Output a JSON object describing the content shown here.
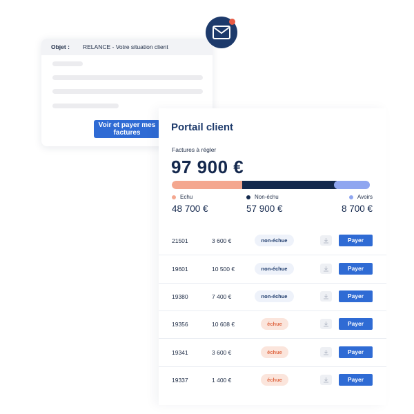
{
  "email": {
    "subject_label": "Objet :",
    "subject_value": "RELANCE - Votre situation client",
    "cta_label": "Voir et payer mes factures",
    "icon": "mail-icon"
  },
  "portal": {
    "title": "Portail client",
    "subtitle": "Factures à régler",
    "total": "97 900 €",
    "breakdown": [
      {
        "label": "Echu",
        "amount": "48 700 €",
        "color": "#f4a78f",
        "share": 0.35
      },
      {
        "label": "Non-échu",
        "amount": "57 900 €",
        "color": "#13294d",
        "share": 0.47
      },
      {
        "label": "Avoirs",
        "amount": "8 700 €",
        "color": "#8fa6f0",
        "share": 0.18
      }
    ],
    "pay_label": "Payer",
    "invoices": [
      {
        "id": "21501",
        "amount": "3 600 €",
        "status": "non-échue",
        "status_kind": "notdue"
      },
      {
        "id": "19601",
        "amount": "10 500 €",
        "status": "non-échue",
        "status_kind": "notdue"
      },
      {
        "id": "19380",
        "amount": "7 400 €",
        "status": "non-échue",
        "status_kind": "notdue"
      },
      {
        "id": "19356",
        "amount": "10 608 €",
        "status": "échue",
        "status_kind": "overdue"
      },
      {
        "id": "19341",
        "amount": "3 600 €",
        "status": "échue",
        "status_kind": "overdue"
      },
      {
        "id": "19337",
        "amount": "1 400 €",
        "status": "échue",
        "status_kind": "overdue"
      }
    ]
  }
}
